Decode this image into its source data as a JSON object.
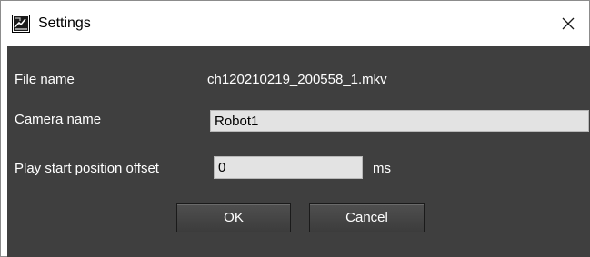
{
  "window": {
    "title": "Settings",
    "icon": "settings-app-icon",
    "close_icon": "close-icon"
  },
  "fields": {
    "file_name": {
      "label": "File name",
      "value": "ch120210219_200558_1.mkv"
    },
    "camera_name": {
      "label": "Camera name",
      "value": "Robot1"
    },
    "offset": {
      "label": "Play start position offset",
      "value": "0",
      "unit": "ms"
    }
  },
  "buttons": {
    "ok": "OK",
    "cancel": "Cancel"
  },
  "colors": {
    "panel_bg": "#3f3f3f",
    "input_bg": "#e3e3e3",
    "text": "#ffffff"
  }
}
